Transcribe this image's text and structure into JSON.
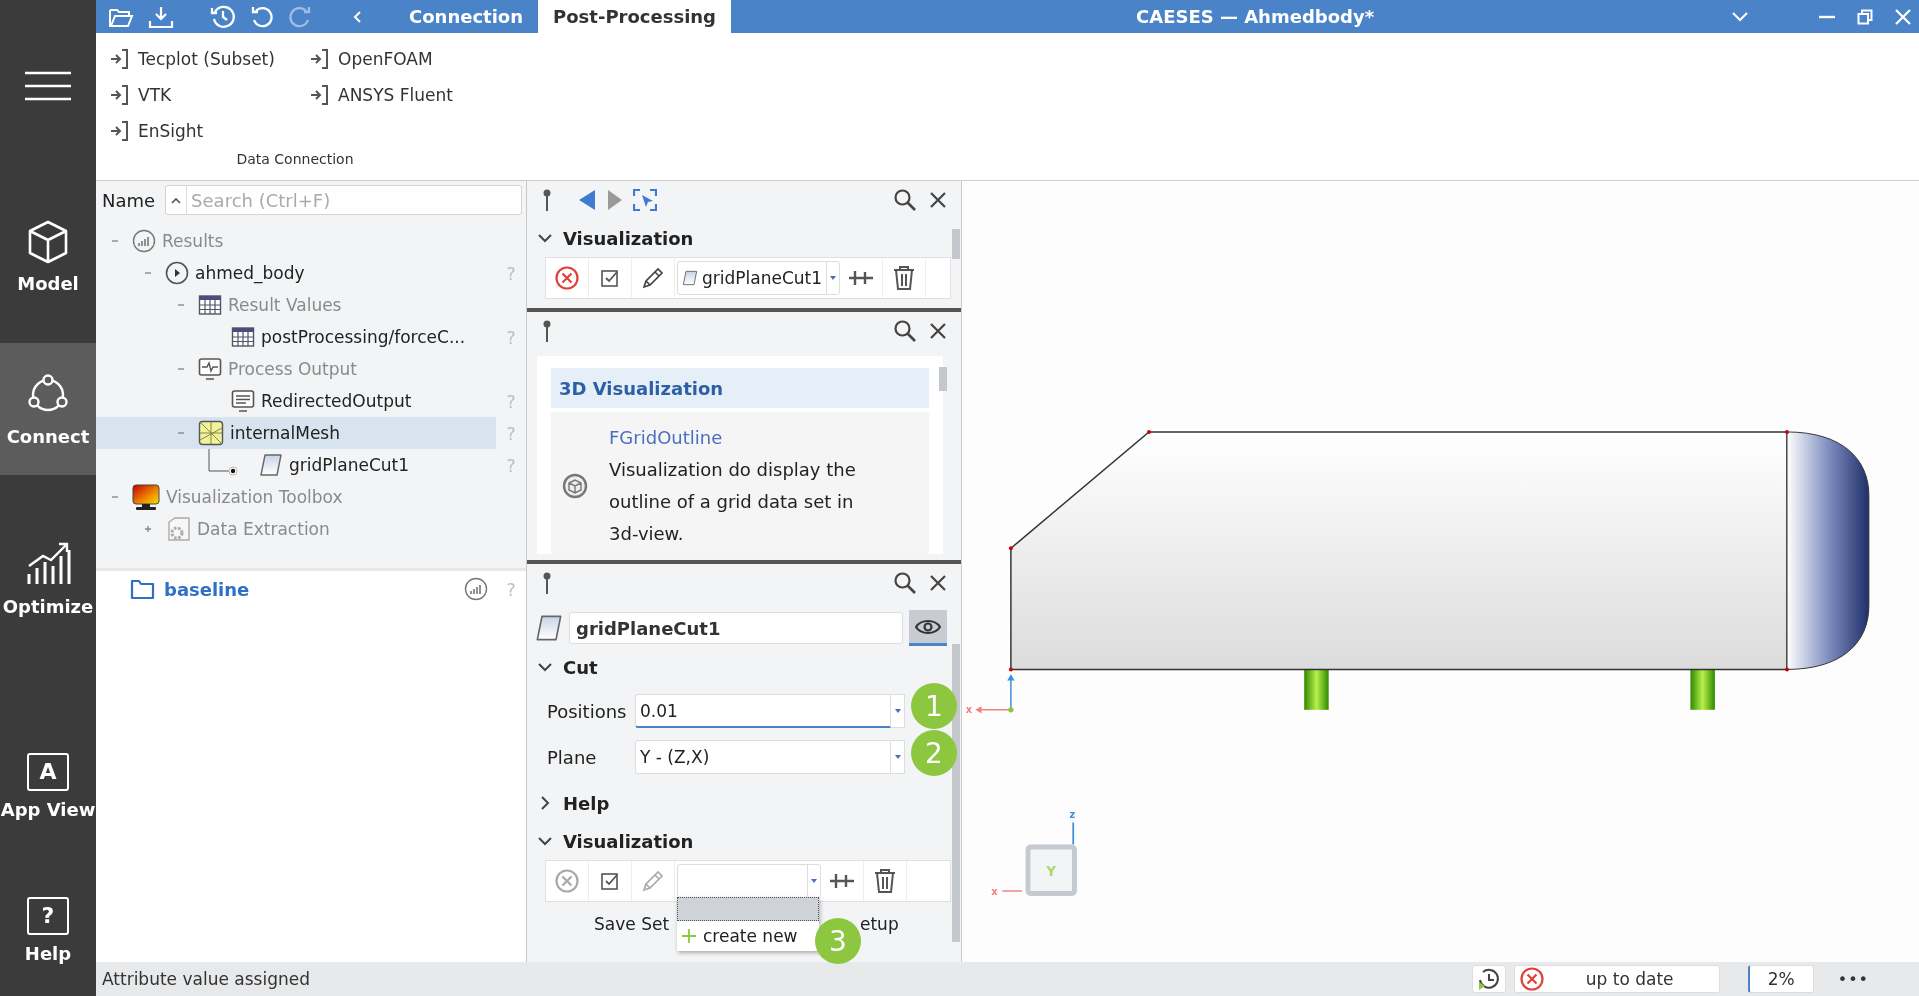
{
  "nav": {
    "items": [
      {
        "label": "Model",
        "selected": false
      },
      {
        "label": "Connect",
        "selected": true
      },
      {
        "label": "Optimize",
        "selected": false
      },
      {
        "label": "App View",
        "glyph": "A",
        "selected": false
      },
      {
        "label": "Help",
        "glyph": "?",
        "selected": false
      }
    ]
  },
  "titlebar": {
    "tabs": [
      {
        "label": "Connection",
        "selected": false
      },
      {
        "label": "Post-Processing",
        "selected": true
      }
    ],
    "title": "CAESES — Ahmedbody*"
  },
  "ribbon": {
    "items": [
      "Tecplot (Subset)",
      "VTK",
      "EnSight",
      "OpenFOAM",
      "ANSYS Fluent"
    ],
    "group": "Data Connection"
  },
  "tree": {
    "column_label": "Name",
    "search": {
      "placeholder": "Search (Ctrl+F)"
    },
    "nodes": [
      {
        "kind": "results",
        "label": "Results",
        "dimmed": true,
        "expanded": true,
        "selected": false,
        "children": [
          {
            "kind": "run",
            "label": "ahmed_body",
            "dimmed": false,
            "expanded": true,
            "selected": false,
            "help": "?",
            "children": [
              {
                "kind": "table",
                "label": "Result Values",
                "dimmed": true,
                "expanded": true,
                "selected": false,
                "children": [
                  {
                    "kind": "table",
                    "label": "postProcessing/forceC...",
                    "dimmed": false,
                    "selected": false,
                    "active": false,
                    "help": "?"
                  }
                ]
              },
              {
                "kind": "monitor",
                "label": "Process Output",
                "dimmed": true,
                "expanded": true,
                "selected": false,
                "children": [
                  {
                    "kind": "document",
                    "label": "RedirectedOutput",
                    "dimmed": false,
                    "selected": false,
                    "active": false,
                    "help": "?"
                  }
                ]
              },
              {
                "kind": "mesh",
                "label": "internalMesh",
                "dimmed": false,
                "expanded": true,
                "selected": true,
                "help": "?",
                "children": [
                  {
                    "kind": "plane",
                    "label": "gridPlaneCut1",
                    "dimmed": false,
                    "selected": false,
                    "active": true,
                    "help": "?"
                  }
                ]
              }
            ]
          }
        ]
      },
      {
        "kind": "toolbox",
        "label": "Visualization Toolbox",
        "dimmed": true,
        "expanded": true,
        "selected": false,
        "children": [
          {
            "kind": "tool",
            "label": "Data Extraction",
            "dimmed": true,
            "expanded": false,
            "selected": false
          }
        ]
      }
    ],
    "project": {
      "label": "baseline",
      "help": "?"
    }
  },
  "visualization_panel": {
    "section": {
      "title": "Visualization",
      "expanded": true
    },
    "toolbar": {
      "error_enabled": true,
      "selection": "gridPlaneCut1",
      "open": false
    }
  },
  "help_panel": {
    "header": "3D Visualization",
    "entry": {
      "title": "FGridOutline",
      "description": "Visualization do display the outline of a grid data set in 3d-view."
    }
  },
  "properties_panel": {
    "name": "gridPlaneCut1",
    "visible": true,
    "sections": [
      {
        "kind": "fields",
        "title": "Cut",
        "expanded": true,
        "fields": [
          {
            "label": "Positions",
            "value": "0.01",
            "focused": true
          },
          {
            "label": "Plane",
            "value": "Y - (Z,X)",
            "focused": false
          }
        ]
      },
      {
        "title": "Help",
        "expanded": false
      },
      {
        "kind": "toolbar",
        "title": "Visualization",
        "expanded": true,
        "toolbar": {
          "error_enabled": false,
          "open": true,
          "menu_item": "create new"
        },
        "buttons": [
          "Save Set",
          "etup"
        ]
      }
    ]
  },
  "callouts": [
    "1",
    "2",
    "3"
  ],
  "viewport": {
    "origin_axis": "x",
    "view_cube": {
      "face": "Y",
      "up": "z",
      "side": "x"
    }
  },
  "status": {
    "message": "Attribute value assigned",
    "error": true,
    "state": "up to date",
    "progress": "2%",
    "more": "•••"
  }
}
